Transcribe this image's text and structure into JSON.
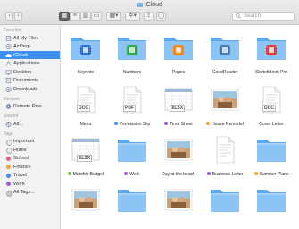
{
  "window": {
    "title": "iCloud"
  },
  "toolbar": {
    "search_placeholder": "Search"
  },
  "sidebar": {
    "favorites_label": "Favorites",
    "favorites": [
      {
        "label": "All My Files",
        "icon": "all-files-icon"
      },
      {
        "label": "AirDrop",
        "icon": "airdrop-icon"
      },
      {
        "label": "iCloud",
        "icon": "cloud-icon",
        "selected": true
      },
      {
        "label": "Applications",
        "icon": "applications-icon"
      },
      {
        "label": "Desktop",
        "icon": "desktop-icon"
      },
      {
        "label": "Documents",
        "icon": "documents-icon"
      },
      {
        "label": "Downloads",
        "icon": "downloads-icon"
      }
    ],
    "devices_label": "Devices",
    "devices": [
      {
        "label": "Remote Disc",
        "icon": "disc-icon"
      }
    ],
    "shared_label": "Shared",
    "shared": [
      {
        "label": "All...",
        "icon": "network-icon"
      }
    ],
    "tags_label": "Tags",
    "tags": [
      {
        "label": "Important",
        "color": "#e8e8e8"
      },
      {
        "label": "Home",
        "color": "#e8e8e8"
      },
      {
        "label": "School",
        "color": "#e65a9a"
      },
      {
        "label": "Finance",
        "color": "#f0a52a"
      },
      {
        "label": "Travel",
        "color": "#3d8ef5"
      },
      {
        "label": "Work",
        "color": "#9c5ad6"
      },
      {
        "label": "All Tags...",
        "color": "#c8c8c8"
      }
    ]
  },
  "files": [
    {
      "label": "Keynote",
      "kind": "folder-app",
      "tag": null
    },
    {
      "label": "Numbers",
      "kind": "folder-app",
      "tag": null
    },
    {
      "label": "Pages",
      "kind": "folder-app",
      "tag": null
    },
    {
      "label": "GoodReader",
      "kind": "folder-app",
      "tag": null
    },
    {
      "label": "SketchBook Pro",
      "kind": "folder-app",
      "tag": null
    },
    {
      "label": "Menu",
      "kind": "doc",
      "badge": "DOC",
      "tag": null
    },
    {
      "label": "Permission Slip",
      "kind": "doc",
      "badge": "PDF",
      "tag": "#3d8ef5"
    },
    {
      "label": "Time Sheet",
      "kind": "sheet",
      "badge": "XLSX",
      "tag": "#9c5ad6"
    },
    {
      "label": "House Remodel",
      "kind": "photo",
      "tag": "#f0a52a"
    },
    {
      "label": "Cover Letter",
      "kind": "doc",
      "badge": "DOC",
      "tag": null
    },
    {
      "label": "Monthly Budget",
      "kind": "sheet",
      "badge": "XLSX",
      "tag": "#7ac142"
    },
    {
      "label": "Work",
      "kind": "folder",
      "tag": "#9c5ad6"
    },
    {
      "label": "Day at the beach",
      "kind": "photo",
      "tag": null
    },
    {
      "label": "Business Letter",
      "kind": "doc",
      "tag": "#9c5ad6"
    },
    {
      "label": "Summer Plans",
      "kind": "folder",
      "tag": "#f0a52a"
    },
    {
      "label": "",
      "kind": "photo",
      "tag": null
    },
    {
      "label": "",
      "kind": "folder",
      "tag": null
    },
    {
      "label": "",
      "kind": "photo",
      "tag": null
    },
    {
      "label": "",
      "kind": "folder",
      "tag": null
    },
    {
      "label": "",
      "kind": "folder",
      "tag": null
    }
  ]
}
